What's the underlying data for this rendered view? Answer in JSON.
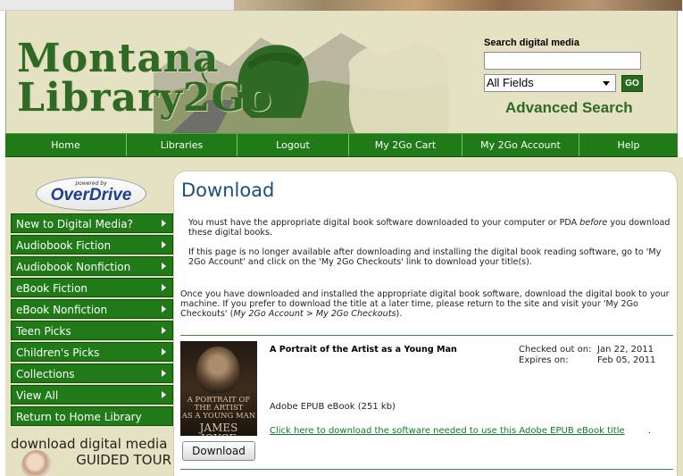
{
  "header": {
    "logo_line1": "Montana",
    "logo_line2": "Library2Go",
    "search_label": "Search digital media",
    "search_value": "",
    "search_field_selected": "All Fields",
    "go_label": "GO",
    "advanced_search_label": "Advanced Search"
  },
  "nav": {
    "items": [
      {
        "label": "Home"
      },
      {
        "label": "Libraries"
      },
      {
        "label": "Logout"
      },
      {
        "label": "My 2Go Cart"
      },
      {
        "label": "My 2Go Account"
      },
      {
        "label": "Help"
      }
    ]
  },
  "sidebar": {
    "badge_small": "powered by",
    "badge_brand": "OverDrive",
    "items": [
      {
        "label": "New to Digital Media?",
        "has_arrow": true
      },
      {
        "label": "Audiobook Fiction",
        "has_arrow": true
      },
      {
        "label": "Audiobook Nonfiction",
        "has_arrow": true
      },
      {
        "label": "eBook Fiction",
        "has_arrow": true
      },
      {
        "label": "eBook Nonfiction",
        "has_arrow": true
      },
      {
        "label": "Teen Picks",
        "has_arrow": true
      },
      {
        "label": "Children's Picks",
        "has_arrow": true
      },
      {
        "label": "Collections",
        "has_arrow": true
      },
      {
        "label": "View All",
        "has_arrow": true
      },
      {
        "label": "Return to Home Library",
        "has_arrow": false
      }
    ],
    "guided_line1": "download digital media",
    "guided_line2": "GUIDED TOUR"
  },
  "main": {
    "title": "Download",
    "para1_a": "You must have the appropriate digital book software downloaded to your computer or PDA ",
    "para1_em": "before",
    "para1_b": " you download these digital books.",
    "para2": "If this page is no longer available after downloading and installing the digital book reading software, go to 'My 2Go Account' and click on the 'My 2Go Checkouts' link to download your title(s).",
    "para3_a": "Once you have downloaded and installed the appropriate digital book software, download the digital book to your machine. If you prefer to download the title at a later time, please return to the site and visit your 'My 2Go Checkouts' (",
    "para3_em": "My 2Go Account > My 2Go Checkouts",
    "para3_b": ").",
    "book": {
      "title": "A Portrait of the Artist as a Young Man",
      "cover_line1": "A PORTRAIT OF",
      "cover_line2": "THE ARTIST",
      "cover_line3": "AS A YOUNG MAN",
      "cover_author": "JAMES JOYCE",
      "checked_out_label": "Checked out on:",
      "checked_out_value": "Jan 22, 2011",
      "expires_label": "Expires on:",
      "expires_value": "Feb 05, 2011",
      "format": "Adobe EPUB eBook (251 kb)",
      "software_link": "Click here to download the software needed to use this Adobe EPUB eBook title",
      "software_link_suffix": ".",
      "download_button": "Download"
    }
  },
  "colors": {
    "nav_green": "#1f7a17",
    "header_bg": "#e5e1c3",
    "title_blue": "#1e4f77",
    "link_green": "#0b7d2c"
  }
}
